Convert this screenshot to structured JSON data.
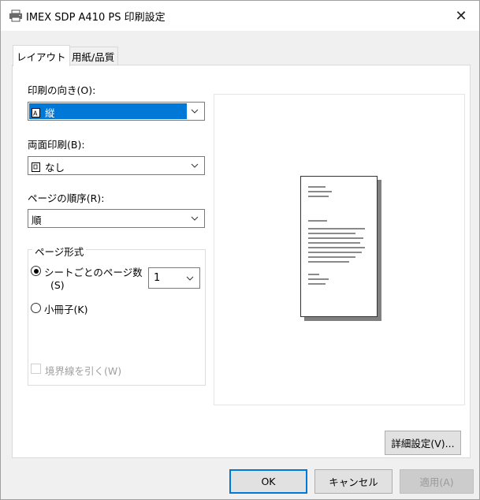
{
  "window": {
    "title": "IMEX SDP A410 PS 印刷設定",
    "close_glyph": "✕"
  },
  "tabs": [
    {
      "label": "レイアウト",
      "active": true
    },
    {
      "label": "用紙/品質",
      "active": false
    }
  ],
  "orientation": {
    "label": "印刷の向き(O):",
    "value": "縦",
    "icon": "portrait-page-icon"
  },
  "duplex": {
    "label": "両面印刷(B):",
    "value": "なし",
    "icon": "single-page-icon"
  },
  "page_order": {
    "label": "ページの順序(R):",
    "value": "順"
  },
  "page_format": {
    "title": "ページ形式",
    "pages_per_sheet_label": "シートごとのページ数",
    "pages_per_sheet_shortcut": "(S)",
    "pages_per_sheet_value": "1",
    "booklet_label": "小冊子(K)",
    "draw_borders_label": "境界線を引く(W)",
    "selected": "pages_per_sheet",
    "draw_borders_checked": false
  },
  "buttons": {
    "advanced": "詳細設定(V)...",
    "ok": "OK",
    "cancel": "キャンセル",
    "apply": "適用(A)"
  },
  "colors": {
    "accent": "#0078d7",
    "window_bg": "#f0f0f0",
    "panel_bg": "#ffffff"
  }
}
